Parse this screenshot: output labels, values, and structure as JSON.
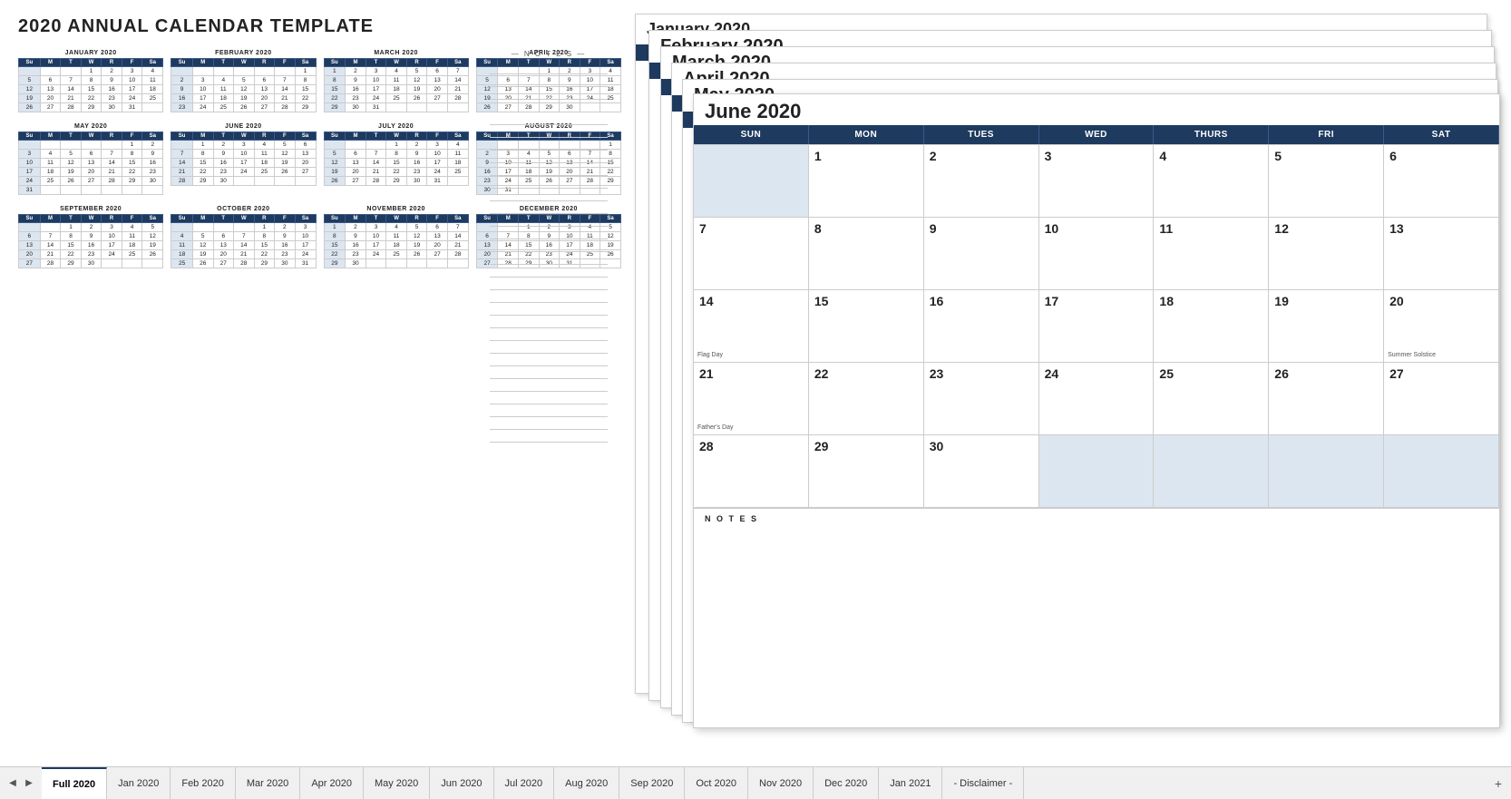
{
  "title": "2020 ANNUAL CALENDAR TEMPLATE",
  "notes_label": "— N O T E S —",
  "months_row1": [
    {
      "name": "JANUARY 2020",
      "days": [
        "Su",
        "M",
        "T",
        "W",
        "R",
        "F",
        "Sa"
      ],
      "weeks": [
        [
          "",
          "",
          "",
          "1",
          "2",
          "3",
          "4"
        ],
        [
          "5",
          "6",
          "7",
          "8",
          "9",
          "10",
          "11"
        ],
        [
          "12",
          "13",
          "14",
          "15",
          "16",
          "17",
          "18"
        ],
        [
          "19",
          "20",
          "21",
          "22",
          "23",
          "24",
          "25"
        ],
        [
          "26",
          "27",
          "28",
          "29",
          "30",
          "31",
          ""
        ]
      ]
    },
    {
      "name": "FEBRUARY 2020",
      "days": [
        "Su",
        "M",
        "T",
        "W",
        "R",
        "F",
        "Sa"
      ],
      "weeks": [
        [
          "",
          "",
          "",
          "",
          "",
          "",
          "1"
        ],
        [
          "2",
          "3",
          "4",
          "5",
          "6",
          "7",
          "8"
        ],
        [
          "9",
          "10",
          "11",
          "12",
          "13",
          "14",
          "15"
        ],
        [
          "16",
          "17",
          "18",
          "19",
          "20",
          "21",
          "22"
        ],
        [
          "23",
          "24",
          "25",
          "26",
          "27",
          "28",
          "29"
        ]
      ]
    },
    {
      "name": "MARCH 2020",
      "days": [
        "Su",
        "M",
        "T",
        "W",
        "R",
        "F",
        "Sa"
      ],
      "weeks": [
        [
          "1",
          "2",
          "3",
          "4",
          "5",
          "6",
          "7"
        ],
        [
          "8",
          "9",
          "10",
          "11",
          "12",
          "13",
          "14"
        ],
        [
          "15",
          "16",
          "17",
          "18",
          "19",
          "20",
          "21"
        ],
        [
          "22",
          "23",
          "24",
          "25",
          "26",
          "27",
          "28"
        ],
        [
          "29",
          "30",
          "31",
          "",
          "",
          "",
          ""
        ]
      ]
    },
    {
      "name": "APRIL 2020",
      "days": [
        "Su",
        "M",
        "T",
        "W",
        "R",
        "F",
        "Sa"
      ],
      "weeks": [
        [
          "",
          "",
          "",
          "1",
          "2",
          "3",
          "4"
        ],
        [
          "5",
          "6",
          "7",
          "8",
          "9",
          "10",
          "11"
        ],
        [
          "12",
          "13",
          "14",
          "15",
          "16",
          "17",
          "18"
        ],
        [
          "19",
          "20",
          "21",
          "22",
          "23",
          "24",
          "25"
        ],
        [
          "26",
          "27",
          "28",
          "29",
          "30",
          "",
          ""
        ]
      ]
    }
  ],
  "months_row2": [
    {
      "name": "MAY 2020",
      "days": [
        "Su",
        "M",
        "T",
        "W",
        "R",
        "F",
        "Sa"
      ],
      "weeks": [
        [
          "",
          "",
          "",
          "",
          "",
          "1",
          "2"
        ],
        [
          "3",
          "4",
          "5",
          "6",
          "7",
          "8",
          "9"
        ],
        [
          "10",
          "11",
          "12",
          "13",
          "14",
          "15",
          "16"
        ],
        [
          "17",
          "18",
          "19",
          "20",
          "21",
          "22",
          "23"
        ],
        [
          "24",
          "25",
          "26",
          "27",
          "28",
          "29",
          "30"
        ],
        [
          "31",
          "",
          "",
          "",
          "",
          "",
          ""
        ]
      ]
    },
    {
      "name": "JUNE 2020",
      "days": [
        "Su",
        "M",
        "T",
        "W",
        "R",
        "F",
        "Sa"
      ],
      "weeks": [
        [
          "",
          "1",
          "2",
          "3",
          "4",
          "5",
          "6"
        ],
        [
          "7",
          "8",
          "9",
          "10",
          "11",
          "12",
          "13"
        ],
        [
          "14",
          "15",
          "16",
          "17",
          "18",
          "19",
          "20"
        ],
        [
          "21",
          "22",
          "23",
          "24",
          "25",
          "26",
          "27"
        ],
        [
          "28",
          "29",
          "30",
          "",
          "",
          "",
          ""
        ]
      ]
    },
    {
      "name": "JULY 2020",
      "days": [
        "Su",
        "M",
        "T",
        "W",
        "R",
        "F",
        "Sa"
      ],
      "weeks": [
        [
          "",
          "",
          "",
          "1",
          "2",
          "3",
          "4"
        ],
        [
          "5",
          "6",
          "7",
          "8",
          "9",
          "10",
          "11"
        ],
        [
          "12",
          "13",
          "14",
          "15",
          "16",
          "17",
          "18"
        ],
        [
          "19",
          "20",
          "21",
          "22",
          "23",
          "24",
          "25"
        ],
        [
          "26",
          "27",
          "28",
          "29",
          "30",
          "31",
          ""
        ]
      ]
    },
    {
      "name": "AUGUST 2020",
      "days": [
        "Su",
        "M",
        "T",
        "W",
        "R",
        "F",
        "Sa"
      ],
      "weeks": [
        [
          "",
          "",
          "",
          "",
          "",
          "",
          "1"
        ],
        [
          "2",
          "3",
          "4",
          "5",
          "6",
          "7",
          "8"
        ],
        [
          "9",
          "10",
          "11",
          "12",
          "13",
          "14",
          "15"
        ],
        [
          "16",
          "17",
          "18",
          "19",
          "20",
          "21",
          "22"
        ],
        [
          "23",
          "24",
          "25",
          "26",
          "27",
          "28",
          "29"
        ],
        [
          "30",
          "31",
          "",
          "",
          "",
          "",
          ""
        ]
      ]
    }
  ],
  "months_row3": [
    {
      "name": "SEPTEMBER 2020",
      "days": [
        "Su",
        "M",
        "T",
        "W",
        "R",
        "F",
        "Sa"
      ],
      "weeks": [
        [
          "",
          "",
          "1",
          "2",
          "3",
          "4",
          "5"
        ],
        [
          "6",
          "7",
          "8",
          "9",
          "10",
          "11",
          "12"
        ],
        [
          "13",
          "14",
          "15",
          "16",
          "17",
          "18",
          "19"
        ],
        [
          "20",
          "21",
          "22",
          "23",
          "24",
          "25",
          "26"
        ],
        [
          "27",
          "28",
          "29",
          "30",
          "",
          "",
          ""
        ]
      ]
    },
    {
      "name": "OCTOBER 2020",
      "days": [
        "Su",
        "M",
        "T",
        "W",
        "R",
        "F",
        "Sa"
      ],
      "weeks": [
        [
          "",
          "",
          "",
          "",
          "1",
          "2",
          "3"
        ],
        [
          "4",
          "5",
          "6",
          "7",
          "8",
          "9",
          "10"
        ],
        [
          "11",
          "12",
          "13",
          "14",
          "15",
          "16",
          "17"
        ],
        [
          "18",
          "19",
          "20",
          "21",
          "22",
          "23",
          "24"
        ],
        [
          "25",
          "26",
          "27",
          "28",
          "29",
          "30",
          "31"
        ]
      ]
    },
    {
      "name": "NOVEMBER 2020",
      "days": [
        "Su",
        "M",
        "T",
        "W",
        "R",
        "F",
        "Sa"
      ],
      "weeks": [
        [
          "1",
          "2",
          "3",
          "4",
          "5",
          "6",
          "7"
        ],
        [
          "8",
          "9",
          "10",
          "11",
          "12",
          "13",
          "14"
        ],
        [
          "15",
          "16",
          "17",
          "18",
          "19",
          "20",
          "21"
        ],
        [
          "22",
          "23",
          "24",
          "25",
          "26",
          "27",
          "28"
        ],
        [
          "29",
          "30",
          "",
          "",
          "",
          "",
          ""
        ]
      ]
    },
    {
      "name": "DECEMBER 2020",
      "days": [
        "Su",
        "M",
        "T",
        "W",
        "R",
        "F",
        "Sa"
      ],
      "weeks": [
        [
          "",
          "",
          "1",
          "2",
          "3",
          "4",
          "5"
        ],
        [
          "6",
          "7",
          "8",
          "9",
          "10",
          "11",
          "12"
        ],
        [
          "13",
          "14",
          "15",
          "16",
          "17",
          "18",
          "19"
        ],
        [
          "20",
          "21",
          "22",
          "23",
          "24",
          "25",
          "26"
        ],
        [
          "27",
          "28",
          "29",
          "30",
          "31",
          "",
          ""
        ]
      ]
    }
  ],
  "stacked_pages": [
    "January 2020",
    "February 2020",
    "March 2020",
    "April 2020",
    "May 2020"
  ],
  "june": {
    "title": "June 2020",
    "col_headers": [
      "SUN",
      "MON",
      "TUES",
      "WED",
      "THURS",
      "FRI",
      "SAT"
    ],
    "weeks": [
      [
        {
          "day": "",
          "empty": true
        },
        {
          "day": "1"
        },
        {
          "day": "2"
        },
        {
          "day": "3"
        },
        {
          "day": "4"
        },
        {
          "day": "5"
        },
        {
          "day": "6"
        }
      ],
      [
        {
          "day": "7"
        },
        {
          "day": "8"
        },
        {
          "day": "9"
        },
        {
          "day": "10"
        },
        {
          "day": "11"
        },
        {
          "day": "12"
        },
        {
          "day": "13"
        }
      ],
      [
        {
          "day": "14",
          "note": "Flag Day"
        },
        {
          "day": "15"
        },
        {
          "day": "16"
        },
        {
          "day": "17"
        },
        {
          "day": "18"
        },
        {
          "day": "19"
        },
        {
          "day": "20",
          "note": "Summer Solstice"
        }
      ],
      [
        {
          "day": "21",
          "note": "Father's Day"
        },
        {
          "day": "22"
        },
        {
          "day": "23"
        },
        {
          "day": "24"
        },
        {
          "day": "25"
        },
        {
          "day": "26"
        },
        {
          "day": "27"
        }
      ],
      [
        {
          "day": "28"
        },
        {
          "day": "29"
        },
        {
          "day": "30"
        },
        {
          "day": "",
          "empty": true
        },
        {
          "day": "",
          "empty": true
        },
        {
          "day": "",
          "empty": true
        },
        {
          "day": "",
          "empty": true
        }
      ]
    ],
    "notes_label": "N O T E S"
  },
  "tabs": [
    {
      "label": "Full 2020",
      "active": true
    },
    {
      "label": "Jan 2020"
    },
    {
      "label": "Feb 2020"
    },
    {
      "label": "Mar 2020"
    },
    {
      "label": "Apr 2020"
    },
    {
      "label": "May 2020"
    },
    {
      "label": "Jun 2020"
    },
    {
      "label": "Jul 2020"
    },
    {
      "label": "Aug 2020"
    },
    {
      "label": "Sep 2020"
    },
    {
      "label": "Oct 2020"
    },
    {
      "label": "Nov 2020"
    },
    {
      "label": "Dec 2020"
    },
    {
      "label": "Jan 2021"
    },
    {
      "label": "- Disclaimer -"
    }
  ]
}
